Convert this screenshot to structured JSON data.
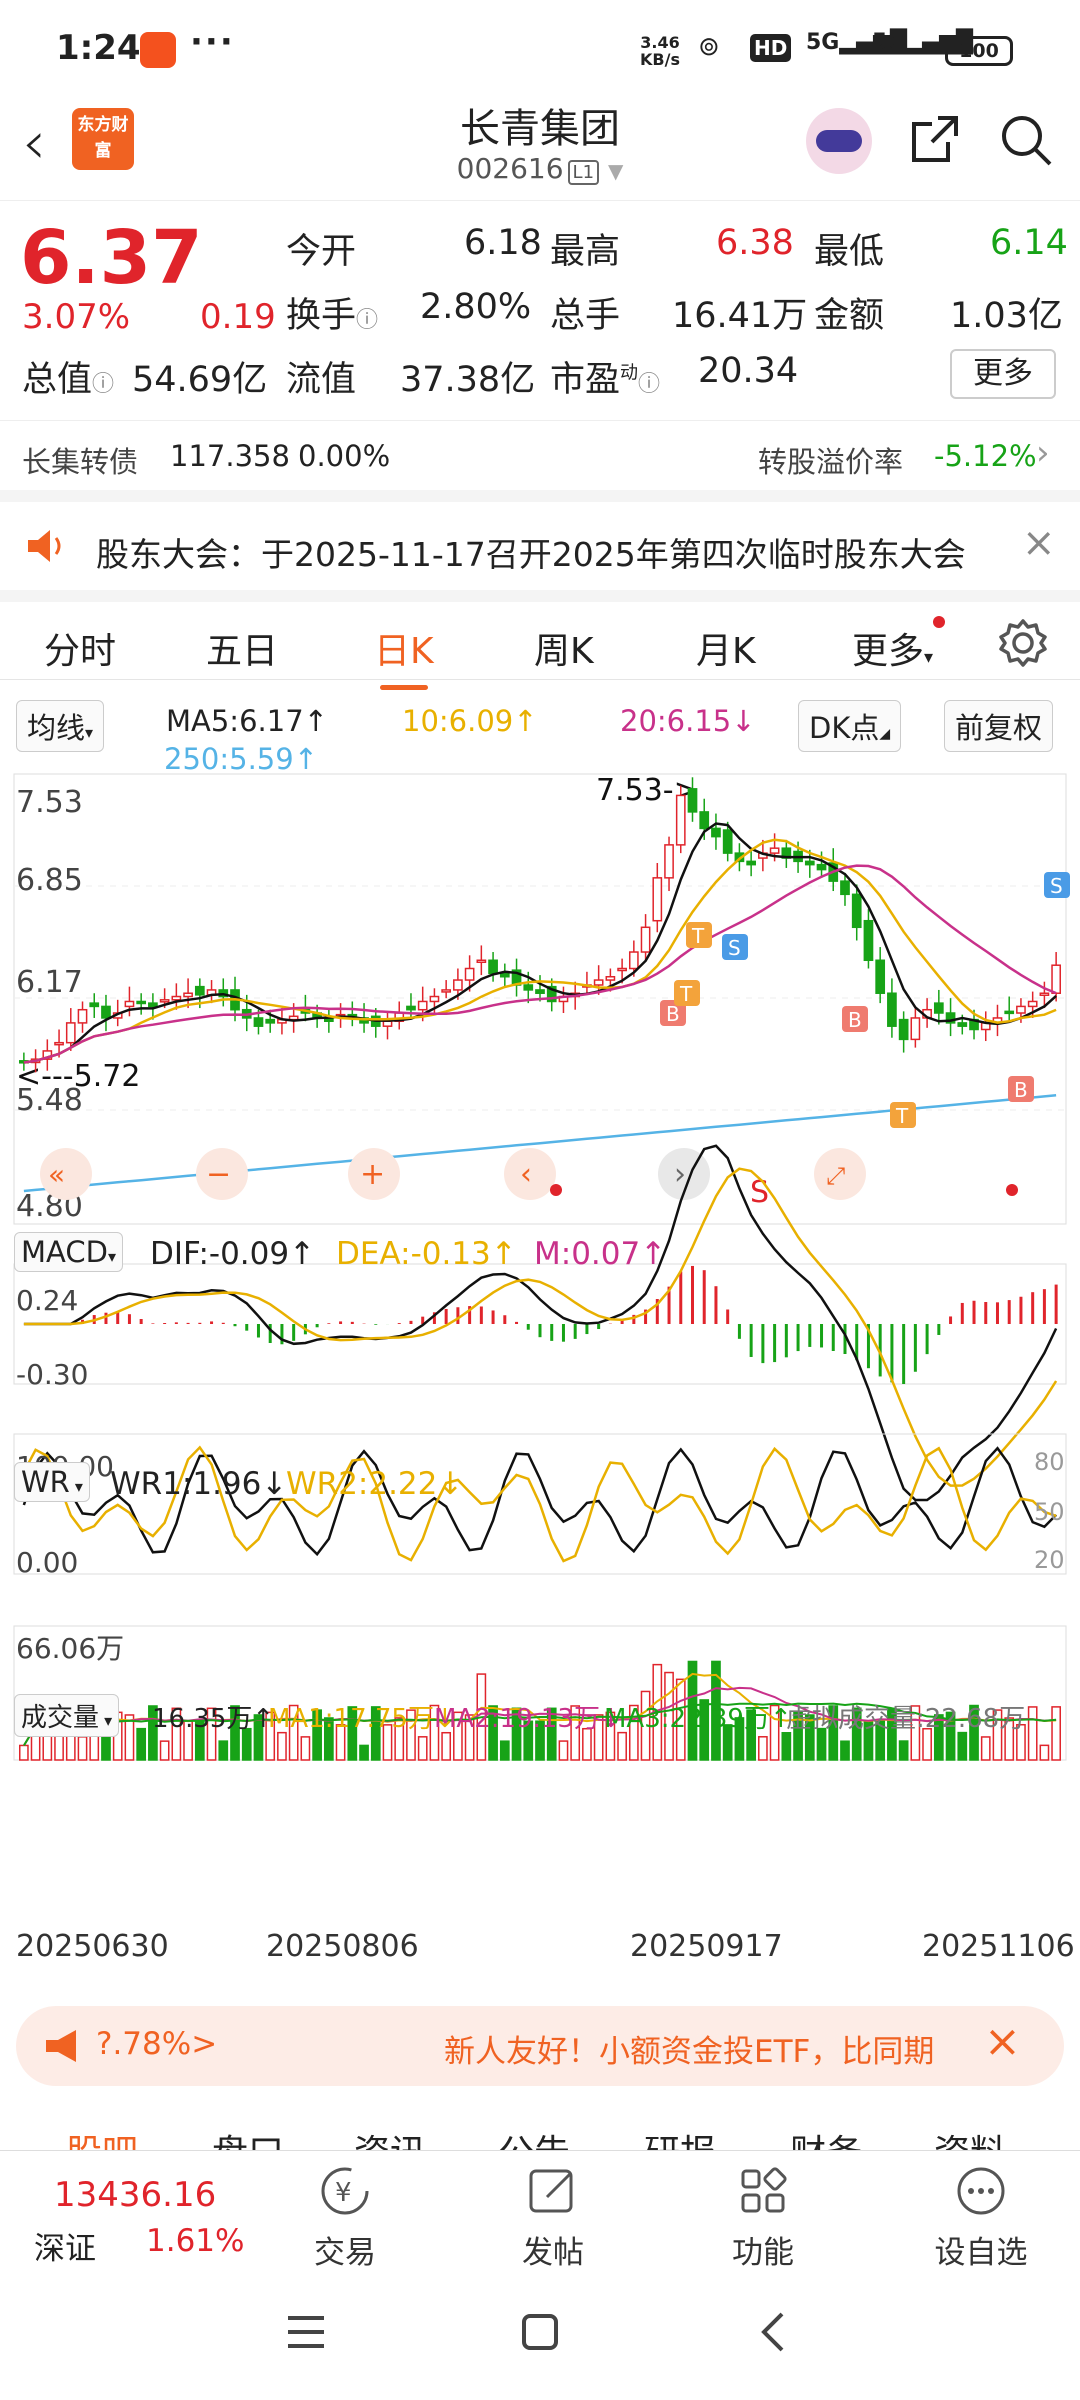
{
  "status": {
    "time": "1:24",
    "net_speed_1": "3.46",
    "net_speed_2": "KB/s",
    "hd": "HD",
    "sig1": "5G",
    "sig2": "5G",
    "battery": "100"
  },
  "header": {
    "title": "长青集团",
    "code": "002616",
    "level": "L1",
    "logo_text": "东方财富"
  },
  "quote": {
    "price": "6.37",
    "change_pct": "3.07%",
    "change": "0.19",
    "open_label": "今开",
    "open": "6.18",
    "high_label": "最高",
    "high": "6.38",
    "low_label": "最低",
    "low": "6.14",
    "turnover_label": "换手",
    "turnover": "2.80%",
    "volume_label": "总手",
    "volume": "16.41万",
    "amount_label": "金额",
    "amount": "1.03亿",
    "mktcap_label": "总值",
    "mktcap": "54.69亿",
    "float_label": "流值",
    "float": "37.38亿",
    "pe_label": "市盈",
    "pe_sup": "动",
    "pe": "20.34",
    "more": "更多"
  },
  "bond": {
    "name": "长集转债",
    "price": "117.358",
    "pct": "0.00%",
    "premium_label": "转股溢价率",
    "premium": "-5.12%"
  },
  "notice": {
    "text": "股东大会：于2025-11-17召开2025年第四次临时股东大会"
  },
  "tabs": [
    "分时",
    "五日",
    "日K",
    "周K",
    "月K",
    "更多"
  ],
  "ma": {
    "selector": "均线",
    "ma5": "MA5:6.17↑",
    "ma10": "10:6.09↑",
    "ma20": "20:6.15↓",
    "ma250": "250:5.59↑",
    "dk": "DK点",
    "adjust": "前复权"
  },
  "kline": {
    "y_labels": [
      "7.53",
      "6.85",
      "6.17",
      "5.48",
      "4.80"
    ],
    "max_label": "7.53->",
    "min_label": "<---5.72",
    "s_label": "S"
  },
  "chart_data": [
    {
      "type": "candlestick",
      "title": "日K",
      "x_ticks": [
        "20250630",
        "20250806",
        "20250917",
        "20251106"
      ],
      "ylim": [
        4.8,
        7.53
      ],
      "closes": [
        5.78,
        5.8,
        5.85,
        5.9,
        6.02,
        6.1,
        6.12,
        6.05,
        6.08,
        6.15,
        6.14,
        6.12,
        6.16,
        6.18,
        6.2,
        6.19,
        6.22,
        6.18,
        6.1,
        6.05,
        6.0,
        6.02,
        6.04,
        6.06,
        6.08,
        6.05,
        6.03,
        6.07,
        6.05,
        6.02,
        6.0,
        6.03,
        6.08,
        6.1,
        6.15,
        6.18,
        6.22,
        6.28,
        6.35,
        6.4,
        6.32,
        6.3,
        6.25,
        6.22,
        6.2,
        6.15,
        6.18,
        6.2,
        6.25,
        6.28,
        6.3,
        6.35,
        6.45,
        6.6,
        6.9,
        7.1,
        7.4,
        7.3,
        7.2,
        7.15,
        7.05,
        7.0,
        6.98,
        7.05,
        7.08,
        7.02,
        7.0,
        6.98,
        6.95,
        6.88,
        6.8,
        6.6,
        6.4,
        6.2,
        6.0,
        5.92,
        6.05,
        6.1,
        6.08,
        6.02,
        6.0,
        5.98,
        6.02,
        6.05,
        6.08,
        6.12,
        6.15,
        6.2,
        6.37
      ],
      "annotations": {
        "max": "7.53",
        "min": "5.72"
      }
    },
    {
      "type": "bar",
      "title": "MACD",
      "legend": [
        "DIF:-0.09↑",
        "DEA:-0.13↑",
        "M:0.07↑"
      ],
      "ylim": [
        -0.3,
        0.24
      ]
    },
    {
      "type": "line",
      "title": "WR",
      "legend": [
        "WR1:1.96↓",
        "WR2:2.22↓"
      ],
      "ylim": [
        0,
        100
      ]
    },
    {
      "type": "bar",
      "title": "成交量",
      "legend": [
        "16.35万↑",
        "MA1:17.75万↓",
        "MA2:19.13万↓",
        "MA3:22.39万↑",
        "虚拟成交量:22.68万"
      ],
      "max_label": "66.06万"
    }
  ],
  "macd": {
    "name": "MACD",
    "dif": "DIF:-0.09↑",
    "dea": "DEA:-0.13↑",
    "m": "M:0.07↑",
    "top": "0.24",
    "bottom": "-0.30"
  },
  "wr": {
    "name": "WR",
    "wr1": "WR1:1.96↓",
    "wr2": "WR2:2.22↓",
    "top": "100.00",
    "bottom": "0.00",
    "r80": "80",
    "r50": "50",
    "r20": "20"
  },
  "vol": {
    "name": "成交量",
    "cur": "16.35万↑",
    "ma1": "MA1:17.75万↓",
    "ma2": "MA2:19.13万↓",
    "ma3": "MA3:22.39万↑",
    "virtual": "虚拟成交量:22.68万",
    "max": "66.06万"
  },
  "dates": [
    "20250630",
    "20250806",
    "20250917",
    "20251106"
  ],
  "promo": {
    "left": "?.78%>",
    "text": "新人友好！小额资金投ETF，比同期"
  },
  "subtabs": [
    "股吧",
    "盘口",
    "资讯",
    "公告",
    "研报",
    "财务",
    "资料"
  ],
  "bottombar": {
    "index_value": "13436.16",
    "index_name": "深证",
    "index_pct": "1.61%",
    "trade": "交易",
    "post": "发帖",
    "func": "功能",
    "fav": "设自选"
  },
  "colors": {
    "up": "#e0242b",
    "down": "#17a317",
    "accent": "#f06222",
    "ma10": "#e8b000",
    "ma20": "#c8318a",
    "ma250": "#55b3e6"
  }
}
